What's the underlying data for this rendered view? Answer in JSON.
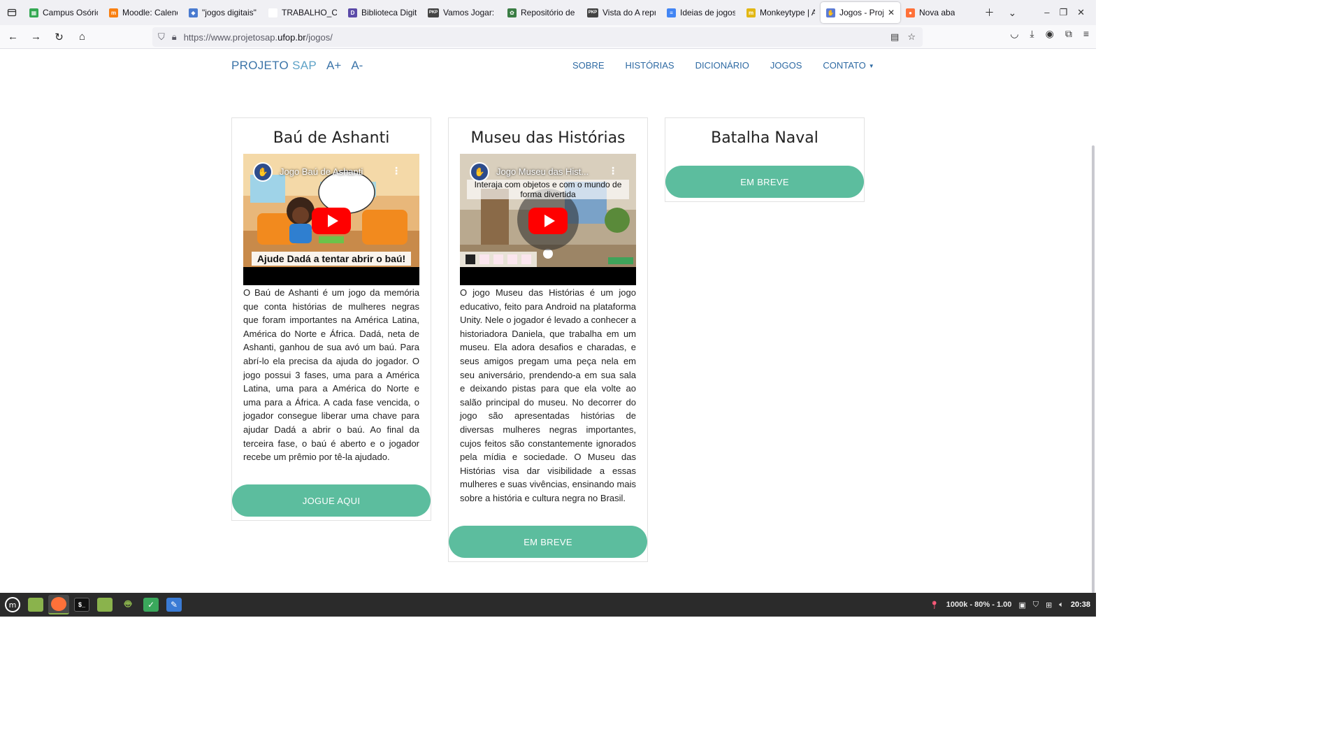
{
  "browser": {
    "tabs": [
      {
        "label": "Campus Osório",
        "fav_color": "#34a853",
        "fav_glyph": "▦"
      },
      {
        "label": "Moodle: Calend",
        "fav_color": "#f98012",
        "fav_glyph": "m"
      },
      {
        "label": "\"jogos digitais\"",
        "fav_color": "#4a7bd0",
        "fav_glyph": "◆"
      },
      {
        "label": "TRABALHO_CO",
        "fav_color": "#ffffff",
        "fav_glyph": ""
      },
      {
        "label": "Biblioteca Digit",
        "fav_color": "#5b4aa8",
        "fav_glyph": "D"
      },
      {
        "label": "Vamos Jogar: m",
        "fav_color": "#444444",
        "fav_glyph": "PKP"
      },
      {
        "label": "Repositório de I",
        "fav_color": "#3a7d44",
        "fav_glyph": "✿"
      },
      {
        "label": "Vista do A repre",
        "fav_color": "#444444",
        "fav_glyph": "PKP"
      },
      {
        "label": "Ideias de jogos",
        "fav_color": "#4285f4",
        "fav_glyph": "≡"
      },
      {
        "label": "Monkeytype | A",
        "fav_color": "#e2b714",
        "fav_glyph": "m"
      },
      {
        "label": "Jogos - Projet",
        "fav_color": "#5b7bd5",
        "fav_glyph": "✋",
        "active": true
      },
      {
        "label": "Nova aba",
        "fav_color": "#ff7139",
        "fav_glyph": "●"
      }
    ],
    "url_prefix": "https://www.projetosap.",
    "url_host": "ufop.br",
    "url_path": "/jogos/"
  },
  "site": {
    "brand_part1": "PROJETO",
    "brand_part2": "SAP",
    "font_plus": "A+",
    "font_minus": "A-",
    "menu": [
      "SOBRE",
      "HISTÓRIAS",
      "DICIONÁRIO",
      "JOGOS",
      "CONTATO"
    ]
  },
  "cards": [
    {
      "title": "Baú de Ashanti",
      "video_title": "Jogo Baú de Ashanti",
      "video_caption": "Ajude Dadá a tentar abrir o baú!",
      "description": "O Baú de Ashanti é um jogo da memória que conta histórias de mulheres negras que foram importantes na América Latina, América do Norte e África. Dadá, neta de Ashanti, ganhou de sua avó um baú. Para abrí-lo ela precisa da ajuda do jogador. O jogo possui 3 fases, uma para a América Latina, uma para a América do Norte e uma para a África. A cada fase vencida, o jogador consegue liberar uma chave para ajudar Dadá a abrir o baú. Ao final da terceira fase, o baú é aberto e o jogador recebe um prêmio por tê-la ajudado.",
      "button": "JOGUE AQUI"
    },
    {
      "title": "Museu das Histórias",
      "video_title": "Jogo Museu das Hist...",
      "video_overlay": "Interaja com objetos e com o mundo de forma divertida",
      "description": "O jogo Museu das Histórias é um jogo educativo, feito para Android na plataforma Unity. Nele o jogador é levado a conhecer a historiadora Daniela, que trabalha em um museu. Ela adora desafios e charadas, e seus amigos pregam uma peça nela em seu aniversário, prendendo-a em sua sala e deixando pistas para que ela volte ao salão principal do museu. No decorrer do jogo são apresentadas histórias de diversas mulheres negras importantes, cujos feitos são constantemente ignorados pela mídia e sociedade. O Museu das Histórias visa dar visibilidade a essas mulheres e suas vivências, ensinando mais sobre a história e cultura negra no Brasil.",
      "button": "EM BREVE"
    },
    {
      "title": "Batalha Naval",
      "button": "EM BREVE"
    }
  ],
  "taskbar": {
    "status": "1000k - 80% - 1.00",
    "clock": "20:38"
  },
  "colors": {
    "accent_button": "#5cbd9e",
    "brand_blue": "#3b74a8",
    "menu_blue": "#2e6aa3"
  }
}
